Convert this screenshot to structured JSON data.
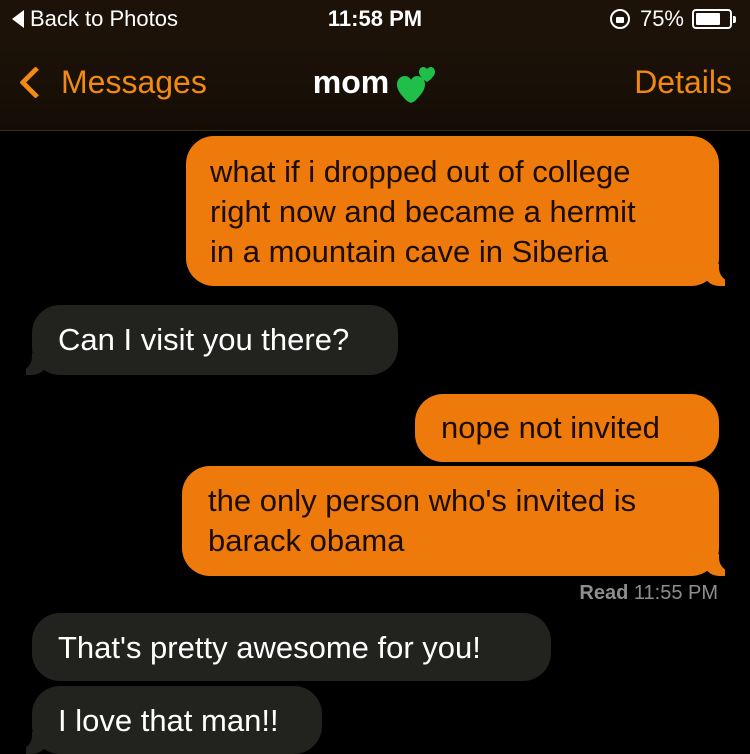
{
  "status_bar": {
    "back_label": "Back to Photos",
    "time": "11:58 PM",
    "battery_percent": "75%",
    "battery_level": 0.75
  },
  "nav": {
    "back_label": "Messages",
    "title": "mom",
    "title_emoji": "green-hearts",
    "details_label": "Details"
  },
  "messages": [
    {
      "direction": "sent",
      "lines": [
        "what if i dropped out of college",
        "right now and became a hermit",
        "in a mountain cave in Siberia"
      ]
    },
    {
      "direction": "received",
      "lines": [
        "Can I visit you there?"
      ]
    },
    {
      "direction": "sent",
      "lines": [
        "nope not invited"
      ]
    },
    {
      "direction": "sent",
      "lines": [
        "the only person who's invited is",
        "barack obama"
      ]
    },
    {
      "direction": "received",
      "lines": [
        "That's pretty awesome for you!"
      ]
    },
    {
      "direction": "received",
      "lines": [
        "I love that man!!"
      ]
    }
  ],
  "read_receipt": {
    "label": "Read",
    "time": "11:55 PM"
  },
  "colors": {
    "accent": "#f08a10",
    "sent_bubble": "#ee7a0c",
    "received_bubble": "#22231f",
    "heart": "#1fbf4a"
  }
}
